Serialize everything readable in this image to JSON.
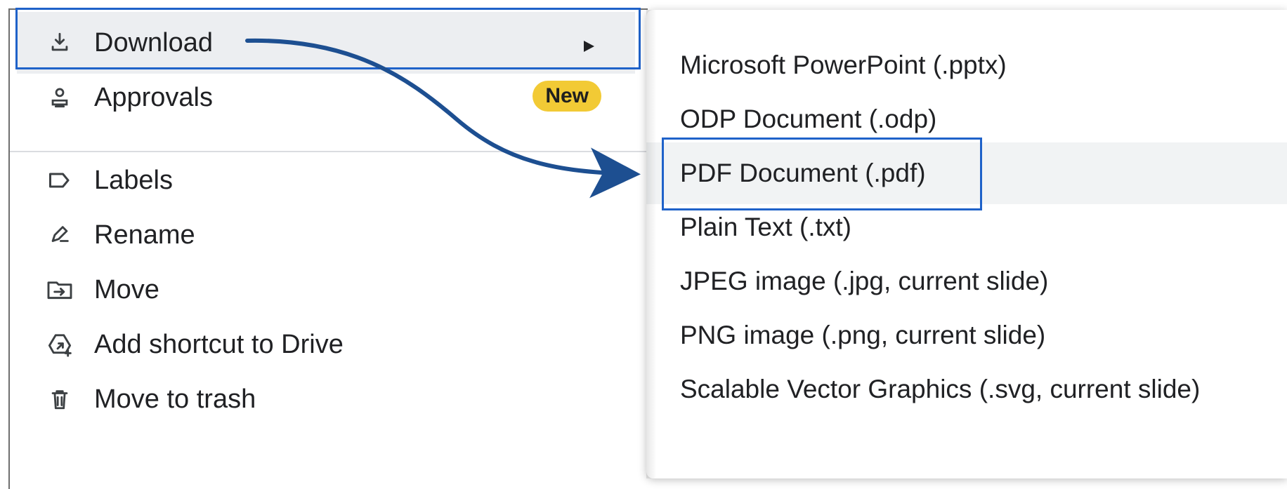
{
  "left_menu": {
    "items": [
      {
        "label": "Download",
        "icon": "download-icon"
      },
      {
        "label": "Approvals",
        "icon": "approvals-icon",
        "badge": "New"
      },
      {
        "label": "Labels",
        "icon": "label-icon"
      },
      {
        "label": "Rename",
        "icon": "rename-icon"
      },
      {
        "label": "Move",
        "icon": "move-folder-icon"
      },
      {
        "label": "Add shortcut to Drive",
        "icon": "drive-shortcut-icon"
      },
      {
        "label": "Move to trash",
        "icon": "trash-icon"
      }
    ]
  },
  "submenu": {
    "items": [
      {
        "label": "Microsoft PowerPoint (.pptx)"
      },
      {
        "label": "ODP Document (.odp)"
      },
      {
        "label": "PDF Document (.pdf)"
      },
      {
        "label": "Plain Text (.txt)"
      },
      {
        "label": "JPEG image (.jpg, current slide)"
      },
      {
        "label": "PNG image (.png, current slide)"
      },
      {
        "label": "Scalable Vector Graphics (.svg, current slide)"
      }
    ]
  },
  "colors": {
    "highlight_border": "#1f62c9",
    "arrow": "#1d4f91",
    "badge": "#f2ca35"
  }
}
